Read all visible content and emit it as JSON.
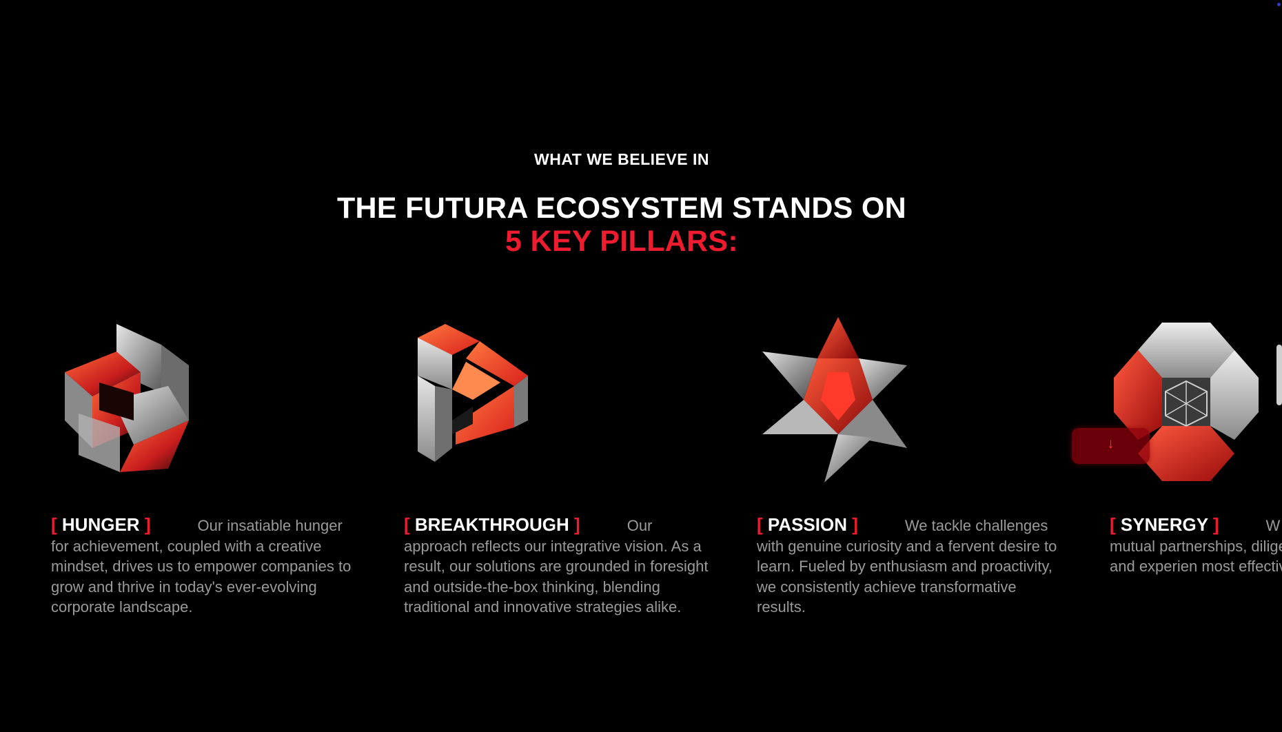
{
  "section": {
    "eyebrow": "WHAT WE BELIEVE IN",
    "headline_line1": "THE FUTURA ECOSYSTEM STANDS ON",
    "headline_line2": "5 KEY PILLARS:"
  },
  "colors": {
    "accent": "#ee1c2e",
    "background": "#000000",
    "body_text": "#9a9a9a"
  },
  "brackets": {
    "open": "[",
    "close": "]"
  },
  "pillars": [
    {
      "name": "HUNGER",
      "icon": "interlocked-cubes-icon",
      "description": "Our insatiable hunger for achievement, coupled with a creative mindset, drives us to empower companies to grow and thrive in today's ever-evolving corporate landscape."
    },
    {
      "name": "BREAKTHROUGH",
      "icon": "impossible-triangle-icon",
      "description": "Our approach reflects our integrative vision. As a result, our solutions are grounded in foresight and outside-the-box thinking, blending traditional and innovative strategies alike."
    },
    {
      "name": "PASSION",
      "icon": "star-tetrahedron-icon",
      "description": "We tackle challenges with genuine curiosity and a fervent desire to learn. Fueled by enthusiasm and proactivity, we consistently achieve transformative results."
    },
    {
      "name": "SYNERGY",
      "icon": "hexagon-lattice-icon",
      "description": "W collaboration and mutual partnerships, diligently co knowledge and experien most effective solutions."
    }
  ],
  "scroll_chip": {
    "arrow": "↓"
  }
}
